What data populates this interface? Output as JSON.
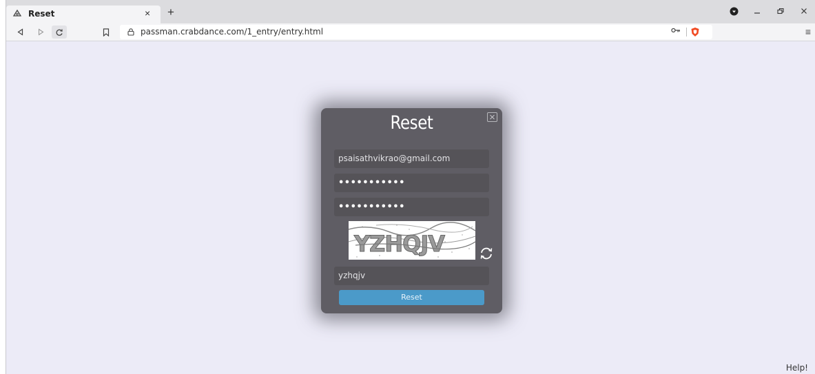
{
  "browser": {
    "tab_title": "Reset",
    "tab_close": "×",
    "new_tab": "+",
    "url": "passman.crabdance.com/1_entry/entry.html",
    "menu": "≡"
  },
  "dialog": {
    "title": "Reset",
    "email_value": "psaisathvikrao@gmail.com",
    "password_value": "•••••••••••",
    "confirm_password_value": "•••••••••••",
    "captcha_text": "YZHQJV",
    "captcha_input_value": "yzhqjv",
    "reset_label": "Reset"
  },
  "help": "Help!"
}
